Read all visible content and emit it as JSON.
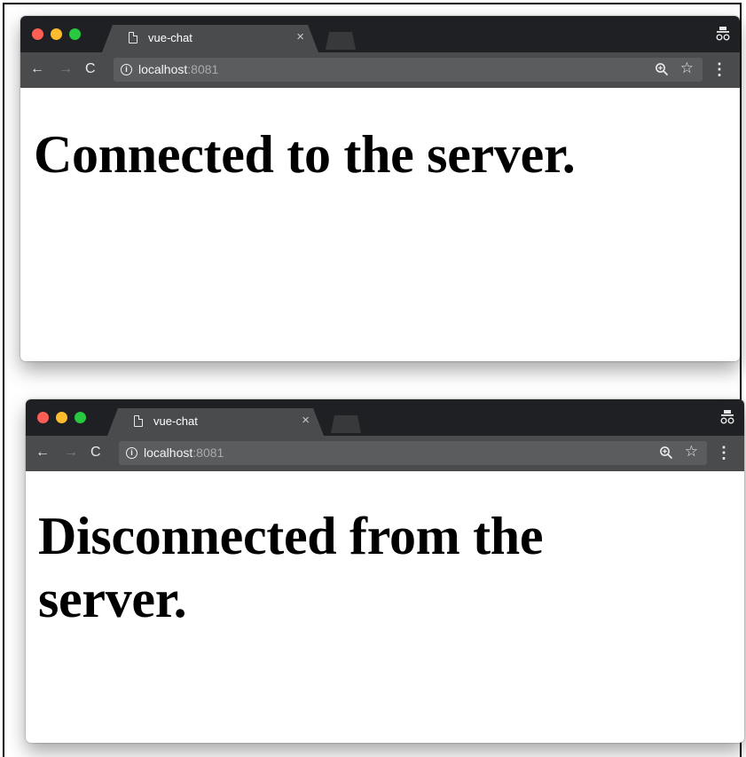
{
  "windows": [
    {
      "tab": {
        "title": "vue-chat",
        "close_glyph": "×"
      },
      "toolbar": {
        "back_glyph": "←",
        "forward_glyph": "→",
        "reload_glyph": "C",
        "url_host": "localhost",
        "url_port": ":8081",
        "info_glyph": "i",
        "star_glyph": "☆",
        "menu_glyph": "⋮"
      },
      "page": {
        "heading": "Connected to the server."
      }
    },
    {
      "tab": {
        "title": "vue-chat",
        "close_glyph": "×"
      },
      "toolbar": {
        "back_glyph": "←",
        "forward_glyph": "→",
        "reload_glyph": "C",
        "url_host": "localhost",
        "url_port": ":8081",
        "info_glyph": "i",
        "star_glyph": "☆",
        "menu_glyph": "⋮"
      },
      "page": {
        "heading": "Disconnected from the server."
      }
    }
  ],
  "icons": {
    "traffic_lights": [
      "close-icon",
      "minimize-icon",
      "maximize-icon"
    ],
    "document": "document-icon",
    "incognito": "incognito-icon",
    "zoom": "zoom-icon"
  },
  "colors": {
    "titlebar": "#1f2023",
    "tab": "#4a4b4d",
    "toolbar": "#4a4b4d",
    "omnibox": "#5b5c5e",
    "close": "#fd5f57",
    "minimize": "#fdbc2e",
    "maximize": "#28c840"
  }
}
